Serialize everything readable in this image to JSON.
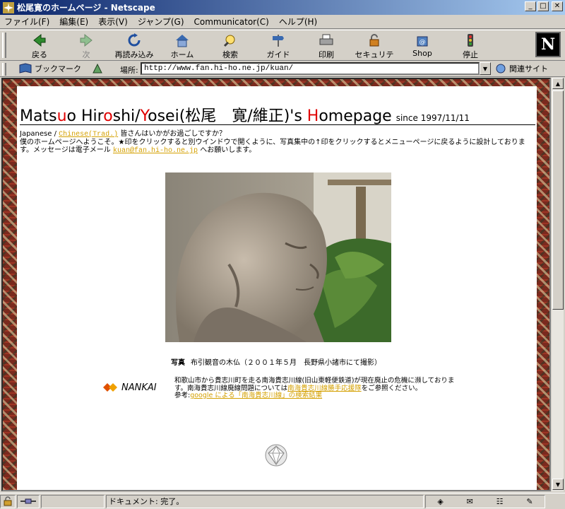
{
  "window": {
    "title": "松尾寛のホームページ - Netscape"
  },
  "menubar": [
    "ファイル(F)",
    "編集(E)",
    "表示(V)",
    "ジャンプ(G)",
    "Communicator(C)",
    "ヘルプ(H)"
  ],
  "toolbar": {
    "back": "戻る",
    "forward": "次",
    "reload": "再読み込み",
    "home": "ホーム",
    "search": "検索",
    "guide": "ガイド",
    "print": "印刷",
    "security": "セキュリティ",
    "shop": "Shop",
    "stop": "停止"
  },
  "location": {
    "bookmarks": "ブックマーク",
    "label": "場所:",
    "url": "http://www.fan.hi-ho.ne.jp/kuan/",
    "related": "関連サイト"
  },
  "page": {
    "heading": {
      "part1a": "Mats",
      "part1red": "u",
      "part1b": "o Hir",
      "part2red": "o",
      "part2b": "shi/",
      "part3red": "Y",
      "part3b": "osei(松尾　寛/維正)'s ",
      "part4red": "H",
      "part4b": "omepage",
      "since": "since 1997/11/11"
    },
    "intro": {
      "japanese": "Japanese /",
      "chinese": "Chinese(Trad.)",
      "greeting": "皆さんはいかがお過ごしですか？",
      "body": "僕のホームページへようこそ。★印をクリックすると別ウインドウで開くように、写真集中の↑印をクリックするとメニューページに戻るように設計しております。メッセージは電子メール",
      "email": "kuan@fan.hi-ho.ne.jp",
      "tail": "へお願いします。"
    },
    "caption": {
      "label": "写真",
      "text": "布引観音の木仏（２００１年５月　長野県小諸市にて撮影）"
    },
    "nankai": {
      "logo": "NANKAI"
    },
    "news": {
      "line1": "和歌山市から貴志川町を走る南海貴志川線(旧山東軽便鉄道)が現在廃止の危機に瀕しております。南海貴志川線廃線問題については",
      "link1": "南海貴志川線勝手応援隊",
      "mid": "をご参照ください。",
      "ref": "参考:",
      "link2": "google による「南海貴志川線」の検索結果"
    }
  },
  "status": {
    "text": "ドキュメント: 完了。"
  }
}
